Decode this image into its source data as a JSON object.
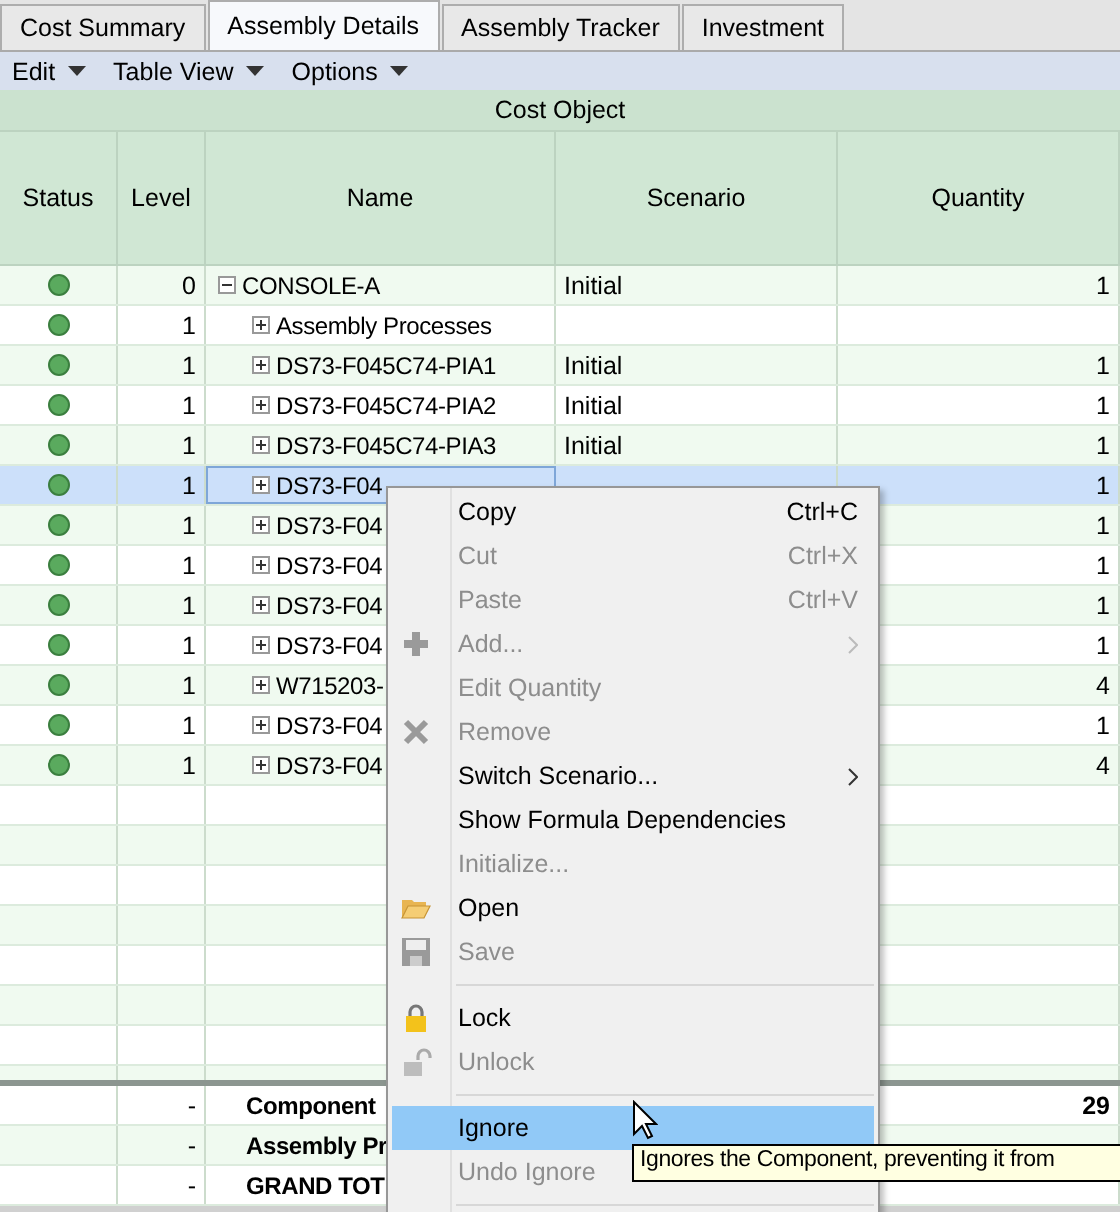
{
  "tabs": [
    {
      "label": "Cost Summary",
      "selected": false
    },
    {
      "label": "Assembly Details",
      "selected": true
    },
    {
      "label": "Assembly Tracker",
      "selected": false
    },
    {
      "label": "Investment",
      "selected": false
    }
  ],
  "menubar": [
    "Edit",
    "Table View",
    "Options"
  ],
  "table": {
    "group_header": "Cost Object",
    "columns": [
      "Status",
      "Level",
      "Name",
      "Scenario",
      "Quantity"
    ],
    "rows": [
      {
        "level": "0",
        "name": "CONSOLE-A",
        "scenario": "Initial",
        "quantity": "1",
        "expanded": true,
        "selected": false,
        "children": [
          {
            "level": "1",
            "name": "Assembly Processes",
            "expanded": false,
            "selected": false
          },
          {
            "level": "1",
            "name": "DS73-F045C74-PIA1",
            "scenario": "Initial",
            "quantity": "1",
            "expanded": false,
            "selected": false
          },
          {
            "level": "1",
            "name": "DS73-F045C74-PIA2",
            "scenario": "Initial",
            "quantity": "1",
            "expanded": false,
            "selected": false
          },
          {
            "level": "1",
            "name": "DS73-F045C74-PIA3",
            "scenario": "Initial",
            "quantity": "1",
            "expanded": false,
            "selected": false
          },
          {
            "level": "1",
            "name": "DS73-F04",
            "quantity": "1",
            "expanded": false,
            "selected": true
          },
          {
            "level": "1",
            "name": "DS73-F04",
            "quantity": "1",
            "expanded": false,
            "selected": false
          },
          {
            "level": "1",
            "name": "DS73-F04",
            "quantity": "1",
            "expanded": false,
            "selected": false
          },
          {
            "level": "1",
            "name": "DS73-F04",
            "quantity": "1",
            "expanded": false,
            "selected": false
          },
          {
            "level": "1",
            "name": "DS73-F04",
            "quantity": "1",
            "expanded": false,
            "selected": false
          },
          {
            "level": "1",
            "name": "W715203-",
            "quantity": "4",
            "expanded": false,
            "selected": false
          },
          {
            "level": "1",
            "name": "DS73-F04",
            "quantity": "1",
            "expanded": false,
            "selected": false
          },
          {
            "level": "1",
            "name": "DS73-F04",
            "quantity": "4",
            "expanded": false,
            "selected": false
          }
        ]
      }
    ],
    "totals": [
      {
        "level": "-",
        "name": "Component",
        "quantity": "29"
      },
      {
        "level": "-",
        "name": "Assembly Pr"
      },
      {
        "level": "-",
        "name": "GRAND TOT"
      }
    ]
  },
  "context_menu": {
    "items": [
      {
        "kind": "item",
        "label": "Copy",
        "shortcut": "Ctrl+C",
        "disabled": false,
        "selected": false
      },
      {
        "kind": "item",
        "label": "Cut",
        "shortcut": "Ctrl+X",
        "disabled": true,
        "selected": false
      },
      {
        "kind": "item",
        "label": "Paste",
        "shortcut": "Ctrl+V",
        "disabled": true,
        "selected": false
      },
      {
        "kind": "item",
        "label": "Add...",
        "disabled": true,
        "submenu": true,
        "selected": false
      },
      {
        "kind": "item",
        "label": "Edit Quantity",
        "disabled": true,
        "selected": false
      },
      {
        "kind": "item",
        "label": "Remove",
        "disabled": true,
        "selected": false
      },
      {
        "kind": "item",
        "label": "Switch Scenario...",
        "disabled": false,
        "submenu": true,
        "selected": false
      },
      {
        "kind": "item",
        "label": "Show Formula Dependencies",
        "disabled": false,
        "selected": false
      },
      {
        "kind": "item",
        "label": "Initialize...",
        "disabled": true,
        "selected": false
      },
      {
        "kind": "item",
        "label": "Open",
        "disabled": false,
        "selected": false
      },
      {
        "kind": "item",
        "label": "Save",
        "disabled": true,
        "selected": false
      },
      {
        "kind": "separator"
      },
      {
        "kind": "item",
        "label": "Lock",
        "disabled": false,
        "selected": false
      },
      {
        "kind": "item",
        "label": "Unlock",
        "disabled": true,
        "selected": false
      },
      {
        "kind": "separator"
      },
      {
        "kind": "item",
        "label": "Ignore",
        "disabled": false,
        "selected": true
      },
      {
        "kind": "item",
        "label": "Undo Ignore",
        "disabled": true,
        "selected": false
      },
      {
        "kind": "separator"
      }
    ]
  },
  "tooltip": "Ignores the Component, preventing it from"
}
